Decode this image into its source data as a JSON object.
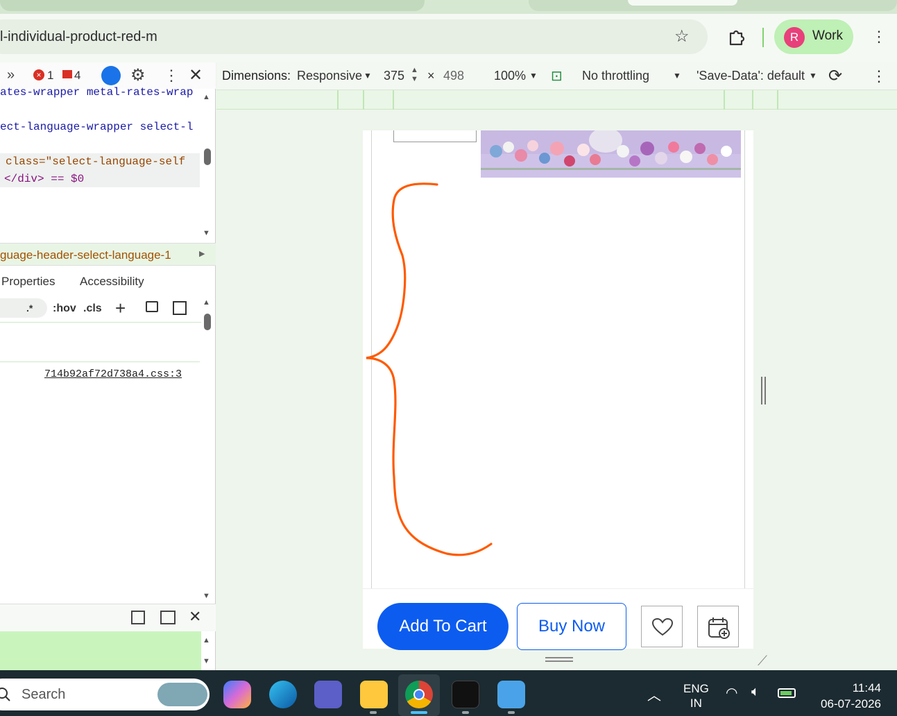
{
  "browser": {
    "url": "l-individual-product-red-m",
    "profile_initial": "R",
    "profile_name": "Work"
  },
  "devtools": {
    "error_count": "1",
    "warning_count": "4",
    "code_lines": [
      "ates-wrapper metal-rates-wrap",
      "ect-language-wrapper select-l",
      "class=\"select-language-self",
      "</div> == $0"
    ],
    "breadcrumb": "guage-header-select-language-1",
    "tabs": [
      "Properties",
      "Accessibility"
    ],
    "filter_tools": [
      ".*",
      ":hov",
      ".cls"
    ],
    "css_source": "714b92af72d738a4.css:3"
  },
  "emulation": {
    "dimensions_label": "Dimensions:",
    "device": "Responsive",
    "width": "375",
    "times": "×",
    "height": "498",
    "zoom": "100%",
    "throttling": "No throttling",
    "save_data": "'Save-Data': default"
  },
  "product_page": {
    "add_to_cart": "Add To Cart",
    "buy_now": "Buy Now"
  },
  "taskbar": {
    "search_label": "Search",
    "lang_top": "ENG",
    "lang_bottom": "IN",
    "time": "11:44",
    "date": "06-07-2026"
  },
  "colors": {
    "accent": "#0c5cf0",
    "annotation": "#ff5a00",
    "profile_chip": "#bff0b5"
  }
}
